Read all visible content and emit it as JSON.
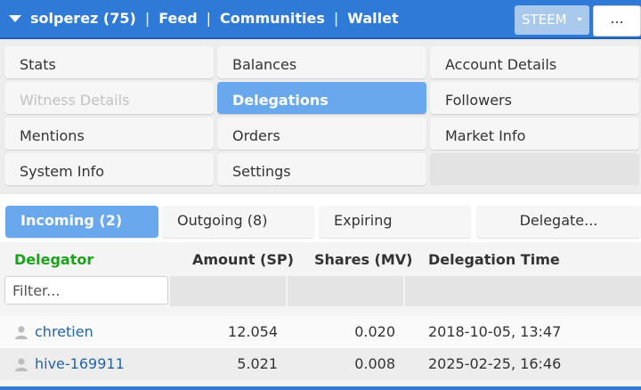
{
  "header": {
    "account": "solperez (75)",
    "links": [
      "Feed",
      "Communities",
      "Wallet"
    ],
    "separator": "|",
    "coin": "STEEM",
    "more": "..."
  },
  "menu": {
    "stats": "Stats",
    "balances": "Balances",
    "account_details": "Account Details",
    "witness_details": "Witness Details",
    "delegations": "Delegations",
    "followers": "Followers",
    "mentions": "Mentions",
    "orders": "Orders",
    "market_info": "Market Info",
    "system_info": "System Info",
    "settings": "Settings"
  },
  "tabs": {
    "incoming": "Incoming (2)",
    "outgoing": "Outgoing (8)",
    "expiring": "Expiring",
    "delegate": "Delegate..."
  },
  "table": {
    "columns": [
      "Delegator",
      "Amount (SP)",
      "Shares (MV)",
      "Delegation Time"
    ],
    "filter_placeholder": "Filter...",
    "rows": [
      {
        "delegator": "chretien",
        "amount": "12.054",
        "shares": "0.020",
        "time": "2018-10-05, 13:47"
      },
      {
        "delegator": "hive-169911",
        "amount": "5.021",
        "shares": "0.008",
        "time": "2025-02-25, 16:46"
      }
    ]
  },
  "colors": {
    "header_blue": "#2e7ad6",
    "active_tab": "#6aa8ed",
    "delegator_green": "#1aa21a",
    "link_blue": "#2465a8"
  },
  "icons": {
    "account_toggle": "chevron-down-icon",
    "user": "user-icon",
    "coin_caret": "caret-down-icon"
  }
}
